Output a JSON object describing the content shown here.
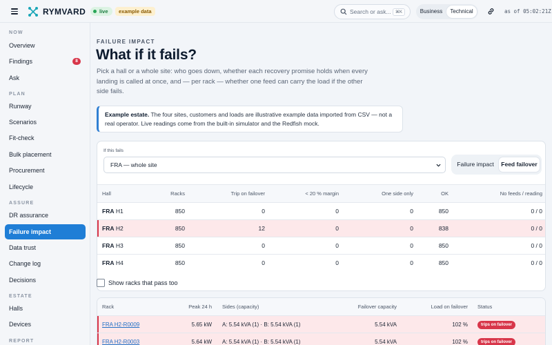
{
  "app": {
    "brand": "RYMVARD",
    "live_label": "live",
    "example_label": "example data",
    "search_placeholder": "Search or ask...",
    "search_shortcut": "⌘K",
    "view_modes": [
      "Business",
      "Technical"
    ],
    "active_view": "Technical",
    "as_of": "as of 05:02:21Z"
  },
  "sidebar": {
    "sections": [
      {
        "title": "NOW",
        "items": [
          {
            "label": "Overview"
          },
          {
            "label": "Findings",
            "badge": "8"
          },
          {
            "label": "Ask"
          }
        ]
      },
      {
        "title": "PLAN",
        "items": [
          {
            "label": "Runway"
          },
          {
            "label": "Scenarios"
          },
          {
            "label": "Fit-check"
          },
          {
            "label": "Bulk placement"
          },
          {
            "label": "Procurement"
          },
          {
            "label": "Lifecycle"
          }
        ]
      },
      {
        "title": "ASSURE",
        "items": [
          {
            "label": "DR assurance"
          },
          {
            "label": "Failure impact",
            "active": true
          },
          {
            "label": "Data trust"
          },
          {
            "label": "Change log"
          },
          {
            "label": "Decisions"
          }
        ]
      },
      {
        "title": "ESTATE",
        "items": [
          {
            "label": "Halls"
          },
          {
            "label": "Devices"
          }
        ]
      },
      {
        "title": "REPORT",
        "items": []
      }
    ]
  },
  "page": {
    "eyebrow": "FAILURE IMPACT",
    "title": "What if it fails?",
    "lede": "Pick a hall or a whole site: who goes down, whether each recovery promise holds when every landing is called at once, and — per rack — whether one feed can carry the load if the other side fails.",
    "callout_bold": "Example estate.",
    "callout_text": " The four sites, customers and loads are illustrative example data imported from CSV — not a real operator. Live readings come from the built-in simulator and the Redfish mock."
  },
  "filter": {
    "label": "If this fails",
    "selected": "FRA — whole site",
    "modes": [
      "Failure impact",
      "Feed failover"
    ],
    "active_mode": "Feed failover"
  },
  "hall_table": {
    "columns": [
      "Hall",
      "Racks",
      "Trip on failover",
      "< 20 % margin",
      "One side only",
      "OK",
      "No feeds / reading"
    ],
    "rows": [
      {
        "site": "FRA",
        "hall": "H1",
        "racks": "850",
        "trip": "0",
        "margin": "0",
        "one_side": "0",
        "ok": "850",
        "no_feeds": "0 / 0",
        "alert": false
      },
      {
        "site": "FRA",
        "hall": "H2",
        "racks": "850",
        "trip": "12",
        "margin": "0",
        "one_side": "0",
        "ok": "838",
        "no_feeds": "0 / 0",
        "alert": true
      },
      {
        "site": "FRA",
        "hall": "H3",
        "racks": "850",
        "trip": "0",
        "margin": "0",
        "one_side": "0",
        "ok": "850",
        "no_feeds": "0 / 0",
        "alert": false
      },
      {
        "site": "FRA",
        "hall": "H4",
        "racks": "850",
        "trip": "0",
        "margin": "0",
        "one_side": "0",
        "ok": "850",
        "no_feeds": "0 / 0",
        "alert": false
      }
    ]
  },
  "show_passing": {
    "label": "Show racks that pass too",
    "checked": false
  },
  "rack_table": {
    "columns": [
      "Rack",
      "Peak 24 h",
      "Sides (capacity)",
      "Failover capacity",
      "Load on failover",
      "Status"
    ],
    "rows": [
      {
        "rack": "FRA H2-R0009",
        "peak": "5.65 kW",
        "sides": "A: 5.54 kVA (1) · B: 5.54 kVA (1)",
        "failover_cap": "5.54 kVA",
        "load": "102 %",
        "status": "trips on failover"
      },
      {
        "rack": "FRA H2-R0003",
        "peak": "5.64 kW",
        "sides": "A: 5.54 kVA (1) · B: 5.54 kVA (1)",
        "failover_cap": "5.54 kVA",
        "load": "102 %",
        "status": "trips on failover"
      }
    ]
  },
  "colors": {
    "accent": "#1f7ed6",
    "danger": "#d8364a",
    "alert_row": "#fde8ea",
    "live_green": "#29a558"
  }
}
